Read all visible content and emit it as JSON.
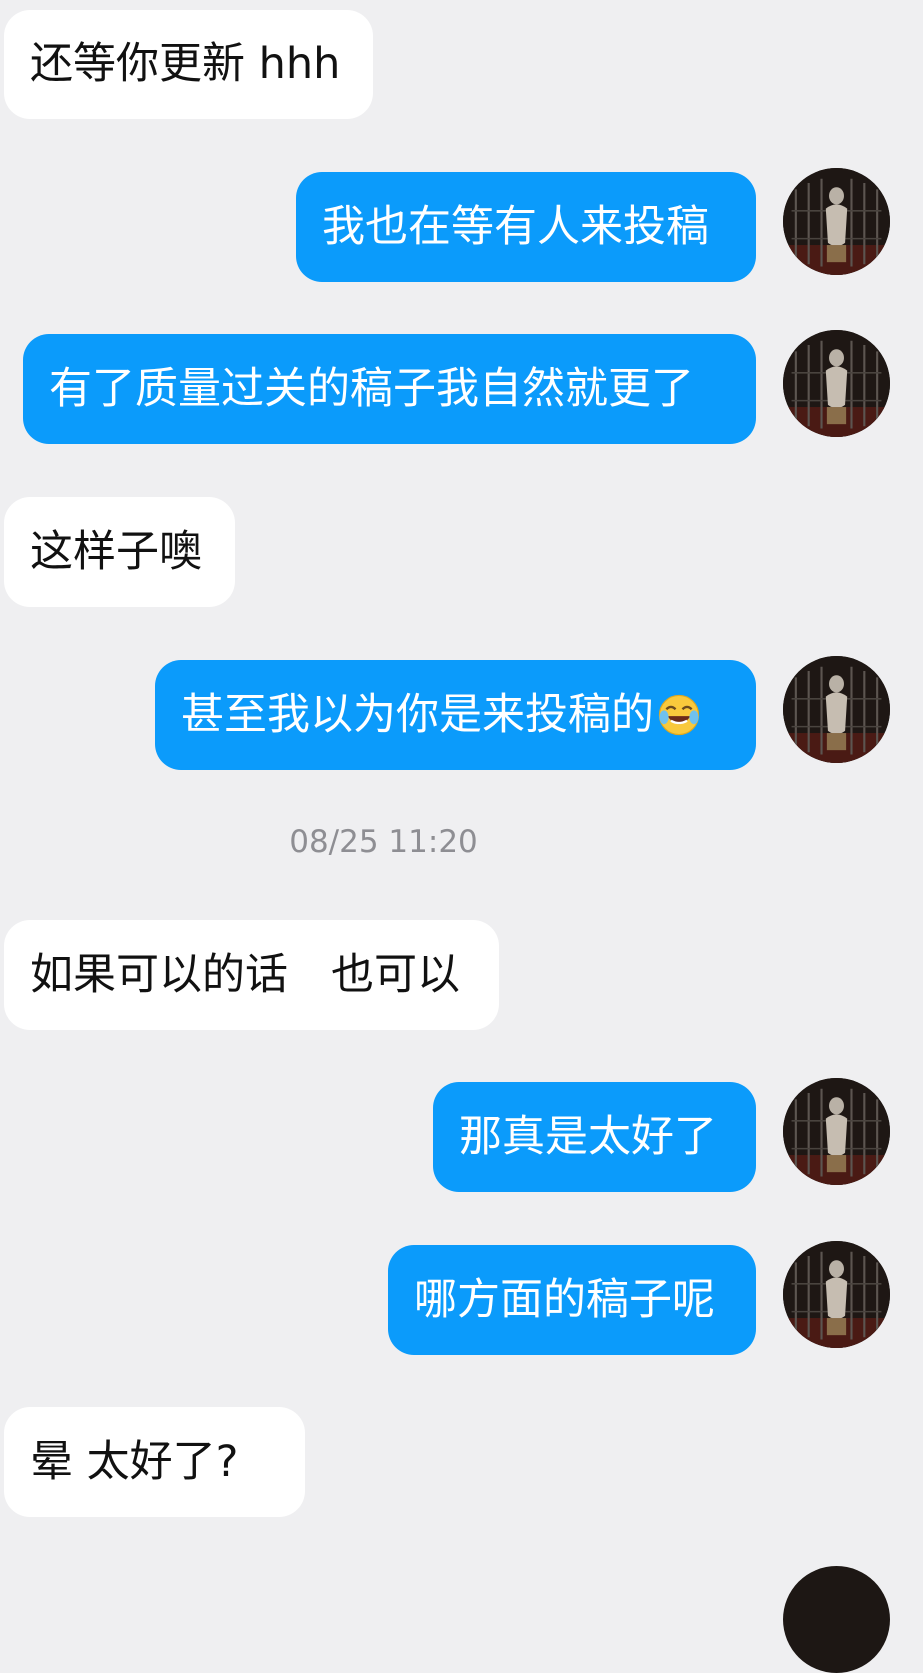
{
  "messages": [
    {
      "side": "in",
      "text": "还等你更新 hhh"
    },
    {
      "side": "out",
      "text": "我也在等有人来投稿"
    },
    {
      "side": "out",
      "text": "有了质量过关的稿子我自然就更了"
    },
    {
      "side": "in",
      "text": "这样子噢"
    },
    {
      "side": "out",
      "text": "甚至我以为你是来投稿的",
      "emoji": "tears-of-joy-emoji"
    },
    {
      "side": "in",
      "text": "如果可以的话　也可以"
    },
    {
      "side": "out",
      "text": "那真是太好了"
    },
    {
      "side": "out",
      "text": "哪方面的稿子呢"
    },
    {
      "side": "in",
      "text": "晕  太好了?"
    }
  ],
  "timestamp": "08/25 11:20",
  "avatar": {
    "icon": "caged-figure-avatar"
  },
  "colors": {
    "background": "#efeff1",
    "incoming_bubble": "#ffffff",
    "outgoing_bubble": "#0b9bfb",
    "timestamp_text": "#8e8e93"
  }
}
